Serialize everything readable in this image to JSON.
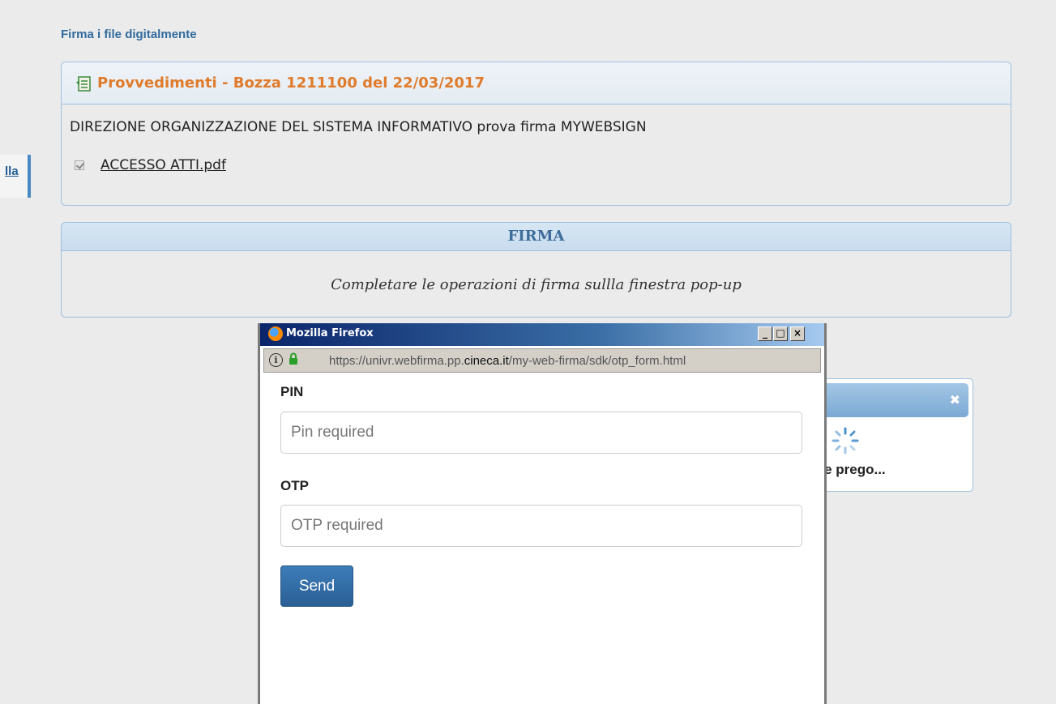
{
  "page": {
    "heading": "Firma i file digitalmente",
    "side_tab_label": "lla"
  },
  "document_panel": {
    "title": "Provvedimenti - Bozza 1211100 del 22/03/2017",
    "description": "DIREZIONE ORGANIZZAZIONE DEL SISTEMA INFORMATIVO prova firma MYWEBSIGN",
    "file": {
      "name": "ACCESSO ATTI.pdf",
      "checked": true
    }
  },
  "sign_panel": {
    "title": "FIRMA",
    "message": "Completare le operazioni di firma sullla finestra pop-up"
  },
  "wait_dialog": {
    "text": "ere prego...",
    "close_icon": "close-icon"
  },
  "popup": {
    "window_title": "Mozilla Firefox",
    "window_buttons": [
      "_",
      "□",
      "×"
    ],
    "url_prefix": "https://univr.webfirma.pp.",
    "url_domain": "cineca.it",
    "url_suffix": "/my-web-firma/sdk/otp_form.html",
    "pin_label": "PIN",
    "pin_placeholder": "Pin required",
    "otp_label": "OTP",
    "otp_placeholder": "OTP required",
    "send_label": "Send"
  },
  "colors": {
    "accent": "#2f6a9d",
    "title_orange": "#e07b2b",
    "button_blue": "#2a5f94"
  }
}
